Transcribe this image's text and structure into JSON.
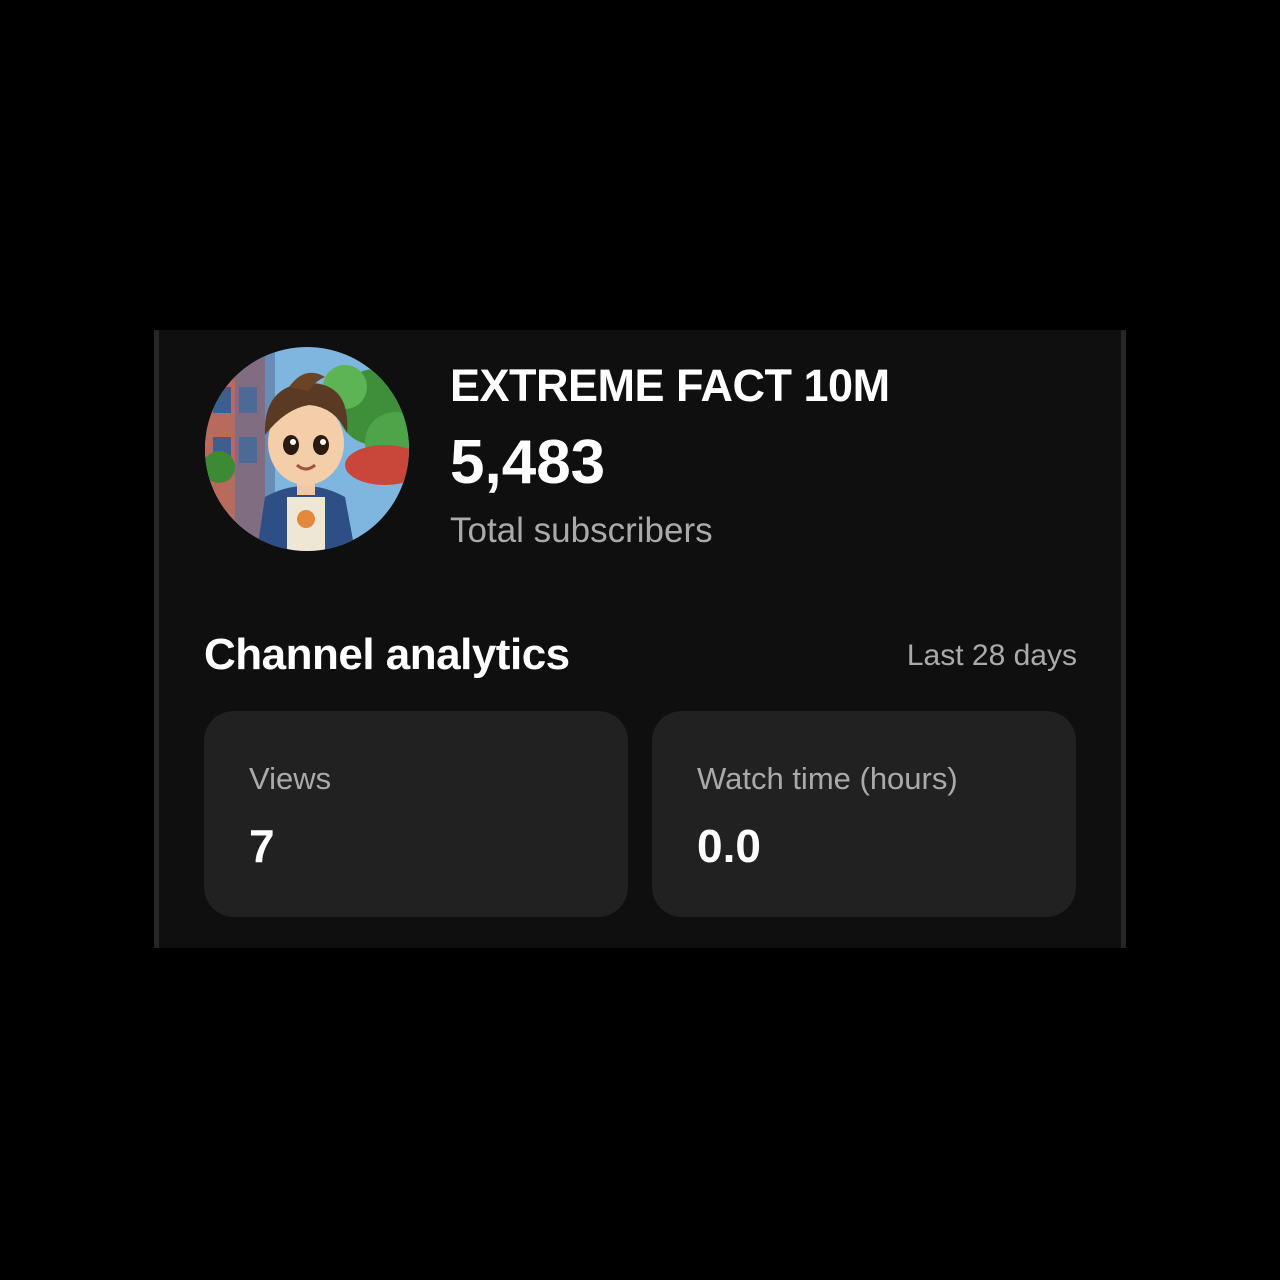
{
  "channel": {
    "avatar_icon": "channel-avatar-cartoon-boy",
    "name": "EXTREME FACT 10M",
    "subscribers": "5,483",
    "subscribers_label": "Total subscribers"
  },
  "analytics": {
    "title": "Channel analytics",
    "period": "Last 28 days",
    "metrics": [
      {
        "label": "Views",
        "value": "7"
      },
      {
        "label": "Watch time (hours)",
        "value": "0.0"
      }
    ]
  },
  "colors": {
    "background": "#000000",
    "card": "#0f0f0f",
    "metric_card": "#212121",
    "primary_text": "#ffffff",
    "secondary_text": "#aaaaaa"
  }
}
